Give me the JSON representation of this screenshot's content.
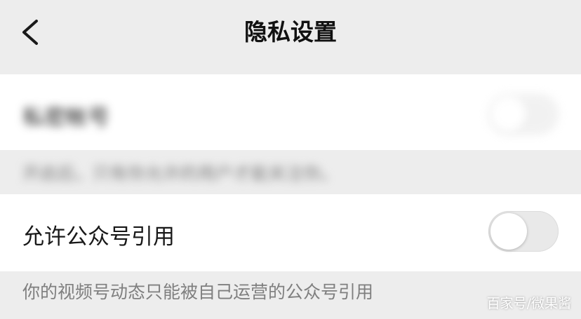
{
  "header": {
    "title": "隐私设置",
    "back_icon": "chevron-left-icon"
  },
  "private_account": {
    "label": "私密帐号",
    "enabled": false,
    "description": "开启后，只有你允许的用户才能关注你。"
  },
  "allow_official_account_quote": {
    "label": "允许公众号引用",
    "enabled": false,
    "description": "你的视频号动态只能被自己运营的公众号引用"
  },
  "watermark": {
    "text": "百家号/微果酱"
  },
  "colors": {
    "background": "#ededed",
    "card": "#ffffff",
    "toggle_off": "#e9e9e9",
    "description_text": "#7f7f7f"
  }
}
